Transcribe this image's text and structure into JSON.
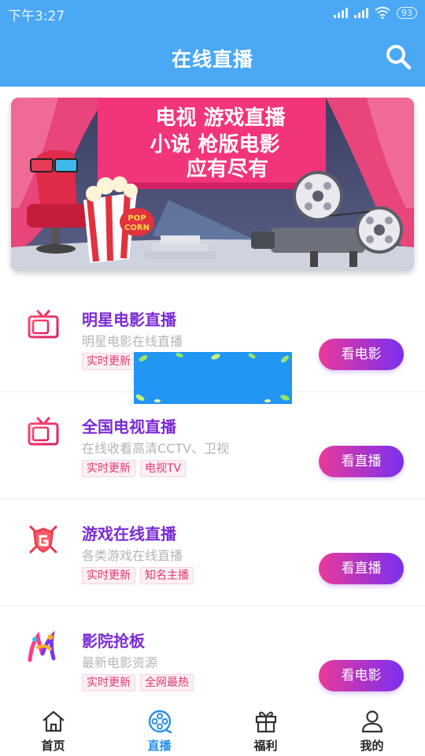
{
  "status_bar": {
    "time": "下午3:27",
    "battery": "93"
  },
  "header": {
    "title": "在线直播"
  },
  "banner": {
    "lines": [
      "电视 游戏直播",
      "小说 枪版电影",
      "应有尽有"
    ],
    "popcorn_text": [
      "POP",
      "CORN"
    ]
  },
  "items": [
    {
      "name": "明星电影直播",
      "subtitle": "明星电影在线直播",
      "tags": [
        "实时更新"
      ],
      "button": "看电影",
      "icon": "tv-icon"
    },
    {
      "name": "全国电视直播",
      "subtitle": "在线收看高清CCTV、卫视",
      "tags": [
        "实时更新",
        "电视TV"
      ],
      "button": "看直播",
      "icon": "tv-icon"
    },
    {
      "name": "游戏在线直播",
      "subtitle": "各类游戏在线直播",
      "tags": [
        "实时更新",
        "知名主播"
      ],
      "button": "看直播",
      "icon": "game-shield-icon"
    },
    {
      "name": "影院抢板",
      "subtitle": "最新电影资源",
      "tags": [
        "实时更新",
        "全网最热"
      ],
      "button": "看电影",
      "icon": "cinema-logo-icon"
    }
  ],
  "nav": [
    {
      "label": "首页",
      "icon": "home-icon",
      "active": false
    },
    {
      "label": "直播",
      "icon": "film-reel-icon",
      "active": true
    },
    {
      "label": "福利",
      "icon": "gift-icon",
      "active": false
    },
    {
      "label": "我的",
      "icon": "user-icon",
      "active": false
    }
  ],
  "colors": {
    "header": "#4aa8f5",
    "accent": "#7b2bd6",
    "tag_text": "#e03a72",
    "nav_active": "#2b8fe6"
  }
}
